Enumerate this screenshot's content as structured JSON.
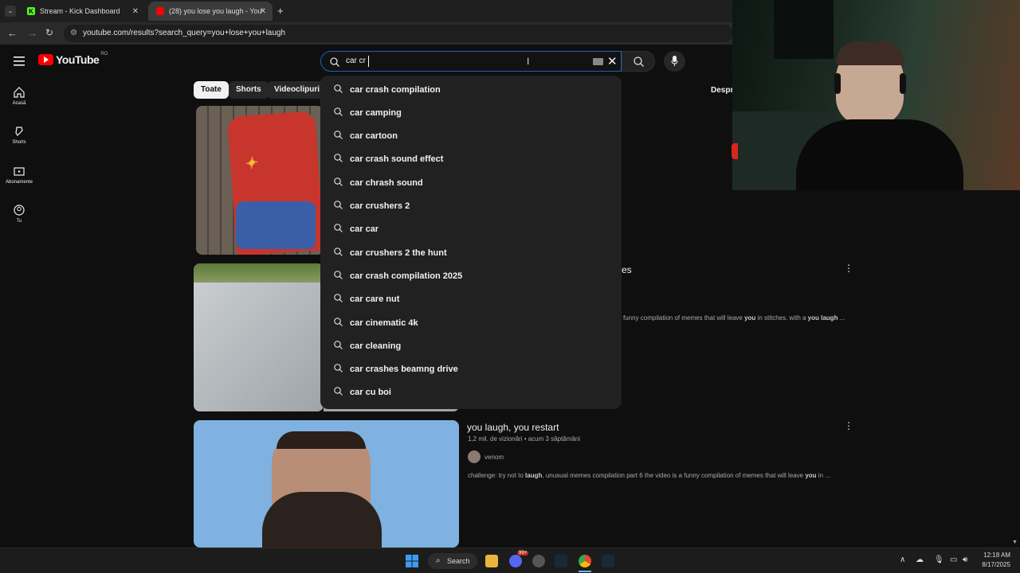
{
  "browser": {
    "tabs": [
      {
        "label": "Stream - Kick Dashboard",
        "active": false
      },
      {
        "label": "(28) you lose you laugh - YouTu",
        "active": true
      }
    ],
    "url": "youtube.com/results?search_query=you+lose+you+laugh"
  },
  "youtube": {
    "logo_text": "YouTube",
    "region": "RO",
    "search_value": "car cr",
    "sidebar": [
      {
        "label": "Acasă",
        "icon": "home-icon"
      },
      {
        "label": "Shorts",
        "icon": "shorts-icon"
      },
      {
        "label": "Abonamente",
        "icon": "subscriptions-icon"
      },
      {
        "label": "Tu",
        "icon": "user-icon"
      }
    ],
    "chips": [
      "Toate",
      "Shorts",
      "Videoclipuri"
    ],
    "chip_right": "Despre",
    "suggestions": [
      "car crash compilation",
      "car camping",
      "car cartoon",
      "car crash sound effect",
      "car chrash sound",
      "car crushers 2",
      "car car",
      "car crushers 2 the hunt",
      "car crash compilation 2025",
      "car care nut",
      "car cinematic 4k",
      "car cleaning",
      "car crashes beamng drive",
      "car cu boi"
    ],
    "videos": [
      {
        "title_fragment": "es",
        "desc_a": "funny compilation of memes that will leave ",
        "desc_b": "you",
        "desc_c": " in stitches. with a ",
        "desc_d": "you laugh",
        "desc_e": " ..."
      },
      {
        "title": "you laugh, you restart",
        "meta": "1,2 mil. de vizionări • acum 3 săptămâni",
        "channel": "venom",
        "desc_a": "challenge: try not to ",
        "desc_b": "laugh",
        "desc_c": ", unusual memes compilation part 6 the video is a funny compilation of memes that will leave ",
        "desc_d": "you",
        "desc_e": " in ..."
      }
    ]
  },
  "taskbar": {
    "search_label": "Search",
    "time": "12:18 AM",
    "date": "8/17/2025",
    "badge": "99+"
  }
}
